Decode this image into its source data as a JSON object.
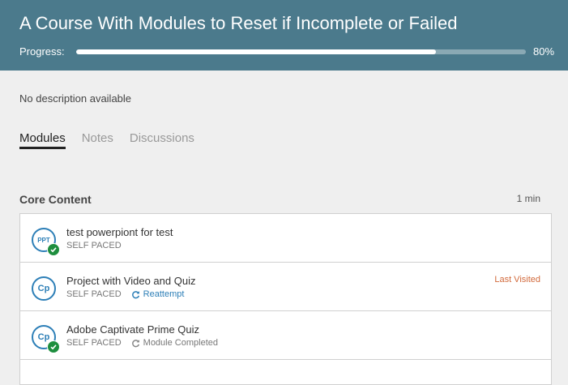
{
  "header": {
    "title": "A Course With Modules to Reset if Incomplete or Failed",
    "progress_label": "Progress:",
    "progress_value": 80,
    "progress_text": "80%"
  },
  "description": "No description available",
  "tabs": [
    {
      "label": "Modules",
      "active": true
    },
    {
      "label": "Notes",
      "active": false
    },
    {
      "label": "Discussions",
      "active": false
    }
  ],
  "section": {
    "title": "Core Content",
    "duration": "1 min"
  },
  "modules": [
    {
      "icon_text": "PPT",
      "icon": "ppt-icon",
      "completed": true,
      "title": "test powerpiont for test",
      "pace": "SELF PACED",
      "action": "",
      "badge": ""
    },
    {
      "icon_text": "Cp",
      "icon": "captivate-icon",
      "completed": false,
      "title": "Project with Video and Quiz",
      "pace": "SELF PACED",
      "action": "Reattempt",
      "badge": "Last Visited"
    },
    {
      "icon_text": "Cp",
      "icon": "captivate-icon",
      "completed": true,
      "title": "Adobe Captivate Prime Quiz",
      "pace": "SELF PACED",
      "action": "Module Completed",
      "badge": ""
    },
    {
      "icon_text": "",
      "icon": "",
      "completed": false,
      "title": "",
      "pace": "",
      "action": "",
      "badge": ""
    }
  ],
  "colors": {
    "header_bg": "#4b7a8c",
    "accent_blue": "#2d7fb7",
    "complete_green": "#1e8e3e",
    "last_visited": "#d26a3c"
  }
}
